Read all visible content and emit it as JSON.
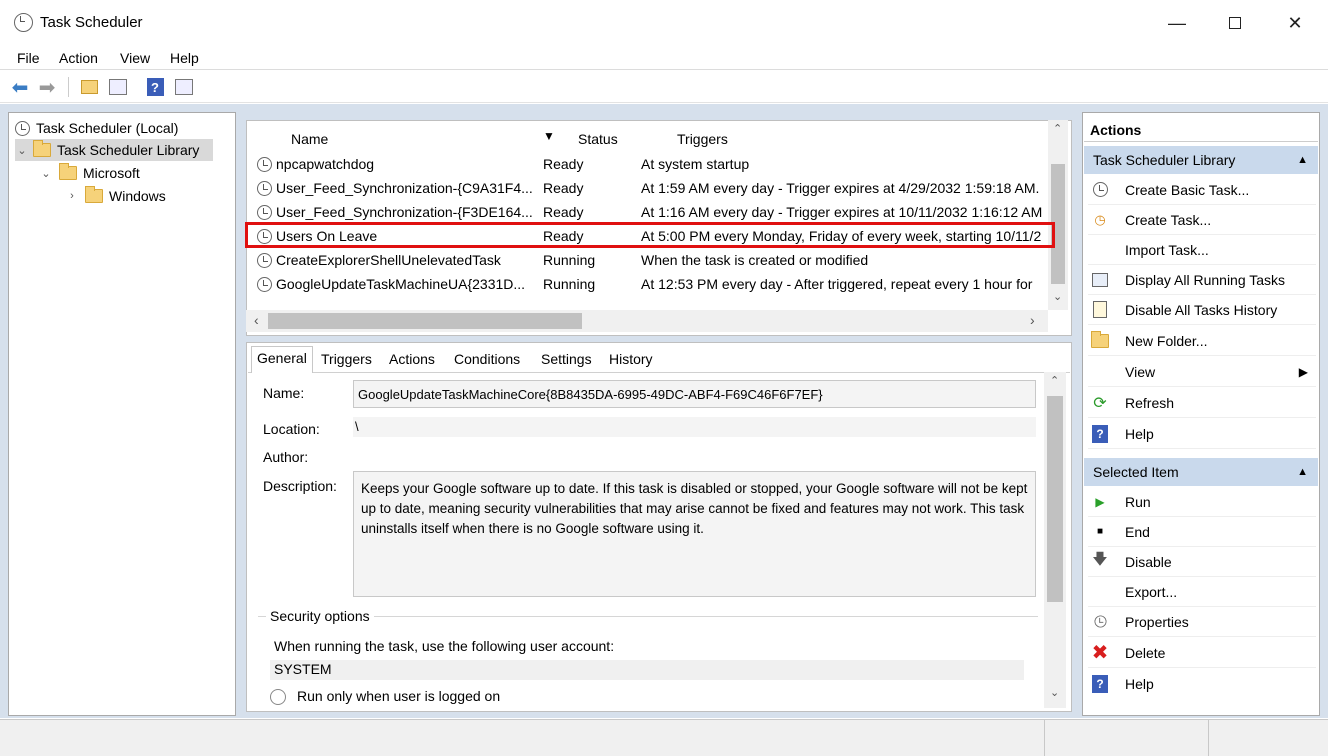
{
  "window": {
    "title": "Task Scheduler"
  },
  "menu": [
    "File",
    "Action",
    "View",
    "Help"
  ],
  "tree": {
    "root": "Task Scheduler (Local)",
    "library": "Task Scheduler Library",
    "microsoft": "Microsoft",
    "windows": "Windows"
  },
  "task_list": {
    "columns": {
      "name": "Name",
      "status": "Status",
      "triggers": "Triggers"
    },
    "rows": [
      {
        "name": "npcapwatchdog",
        "status": "Ready",
        "trigger": "At system startup"
      },
      {
        "name": "User_Feed_Synchronization-{C9A31F4...",
        "status": "Ready",
        "trigger": "At 1:59 AM every day - Trigger expires at 4/29/2032 1:59:18 AM."
      },
      {
        "name": "User_Feed_Synchronization-{F3DE164...",
        "status": "Ready",
        "trigger": "At 1:16 AM every day - Trigger expires at 10/11/2032 1:16:12 AM"
      },
      {
        "name": "Users On Leave",
        "status": "Ready",
        "trigger": "At 5:00 PM every Monday, Friday of every week, starting 10/11/2"
      },
      {
        "name": "CreateExplorerShellUnelevatedTask",
        "status": "Running",
        "trigger": "When the task is created or modified"
      },
      {
        "name": "GoogleUpdateTaskMachineUA{2331D...",
        "status": "Running",
        "trigger": "At 12:53 PM every day - After triggered, repeat every 1 hour for"
      }
    ]
  },
  "detail": {
    "tabs": [
      "General",
      "Triggers",
      "Actions",
      "Conditions",
      "Settings",
      "History"
    ],
    "labels": {
      "name": "Name:",
      "location": "Location:",
      "author": "Author:",
      "description": "Description:"
    },
    "name_value": "GoogleUpdateTaskMachineCore{8B8435DA-6995-49DC-ABF4-F69C46F6F7EF}",
    "location_value": "\\",
    "author_value": "",
    "description_value": "Keeps your Google software up to date. If this task is disabled or stopped, your Google software will not be kept up to date, meaning security vulnerabilities that may arise cannot be fixed and features may not work. This task uninstalls itself when there is no Google software using it.",
    "security": {
      "title": "Security options",
      "account_prompt": "When running the task, use the following user account:",
      "account": "SYSTEM",
      "radio_label": "Run only when user is logged on"
    }
  },
  "actions": {
    "header": "Actions",
    "section1": "Task Scheduler Library",
    "section1_items": [
      "Create Basic Task...",
      "Create Task...",
      "Import Task...",
      "Display All Running Tasks",
      "Disable All Tasks History",
      "New Folder...",
      "View",
      "Refresh",
      "Help"
    ],
    "section2": "Selected Item",
    "section2_items": [
      "Run",
      "End",
      "Disable",
      "Export...",
      "Properties",
      "Delete",
      "Help"
    ]
  },
  "colors": {
    "highlight_border": "#e01010",
    "section_header": "#c9d9ec",
    "pane_bg": "#d6e0ec"
  }
}
